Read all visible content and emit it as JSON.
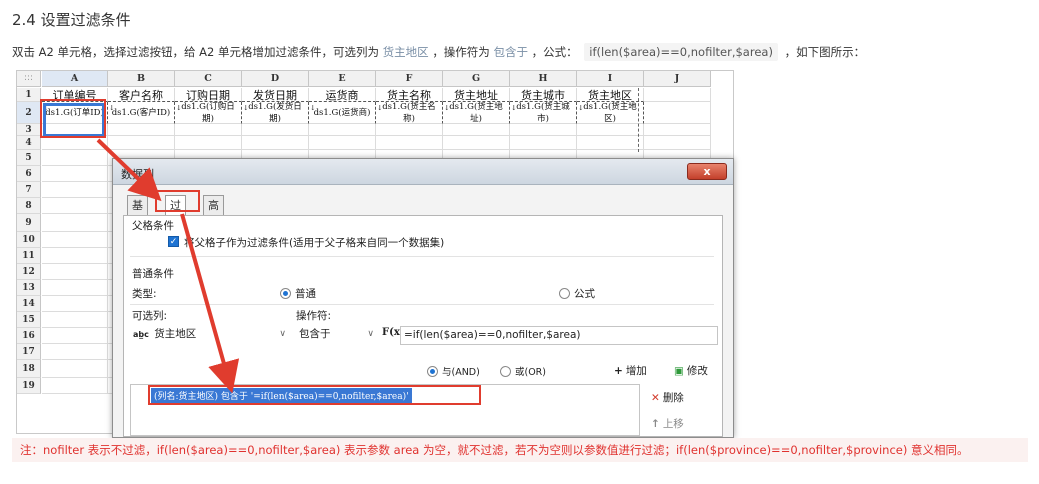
{
  "doc": {
    "title": "2.4 设置过滤条件",
    "intro_part1": "双击 A2 单元格，选择过滤按钮，给 A2 单元格增加过滤条件，可选列为",
    "intro_hl1": "货主地区",
    "intro_part2": "，操作符为",
    "intro_hl2": "包含于",
    "intro_part3": "，公式：",
    "intro_code": "if(len($area)==0,nofilter,$area)",
    "intro_part4": "，如下图所示：",
    "note": "注：nofilter 表示不过滤，if(len($area)==0,nofilter,$area) 表示参数 area 为空，就不过滤，若不为空则以参数值进行过滤；if(len($province)==0,nofilter,$province) 意义相同。"
  },
  "sheet": {
    "corner": ":::",
    "columns": [
      "A",
      "B",
      "C",
      "D",
      "E",
      "F",
      "G",
      "H",
      "I",
      "J"
    ],
    "rows": [
      "1",
      "2",
      "3",
      "4",
      "5",
      "6",
      "7",
      "8",
      "9",
      "10",
      "11",
      "12",
      "13",
      "14",
      "15",
      "16",
      "17",
      "18",
      "19"
    ],
    "row1": [
      "订单编号",
      "客户名称",
      "订购日期",
      "发货日期",
      "运货商",
      "货主名称",
      "货主地址",
      "货主城市",
      "货主地区"
    ],
    "row2": [
      "ds1.G(订单ID)",
      "ds1.G(客户ID)",
      "ds1.G(订购日期)",
      "ds1.G(发货日期)",
      "ds1.G(运货商)",
      "ds1.G(货主名称)",
      "ds1.G(货主地址)",
      "ds1.G(货主城市)",
      "ds1.G(货主地区)"
    ],
    "expand_mark": "↓"
  },
  "dialog": {
    "title": "数据列",
    "close": "x",
    "tabs": [
      "基本",
      "过滤",
      "高级"
    ],
    "parent_group": "父格条件",
    "parent_checkbox": "将父格子作为过滤条件(适用于父子格来自同一个数据集)",
    "normal_group": "普通条件",
    "type_label": "类型:",
    "type_normal": "普通",
    "type_formula": "公式",
    "column_label": "可选列:",
    "operator_label": "操作符:",
    "column_value": "货主地区",
    "column_icon": "abc-icon",
    "operator_value": "包含于",
    "fx_label": "F(x)",
    "formula_value": "=if(len($area)==0,nofilter,$area)",
    "and_label": "与(AND)",
    "or_label": "或(OR)",
    "add_icon": "+",
    "add_label": "增加",
    "modify_label": "修改",
    "delete_icon": "✕",
    "delete_label": "删除",
    "up_icon": "↑",
    "up_label": "上移",
    "condition_item": "(列名:货主地区) 包含于 '=if(len($area)==0,nofilter,$area)'"
  },
  "colors": {
    "accent": "#3a78d4",
    "highlight": "#e03c2e",
    "note_bg": "#fbf1f0"
  }
}
